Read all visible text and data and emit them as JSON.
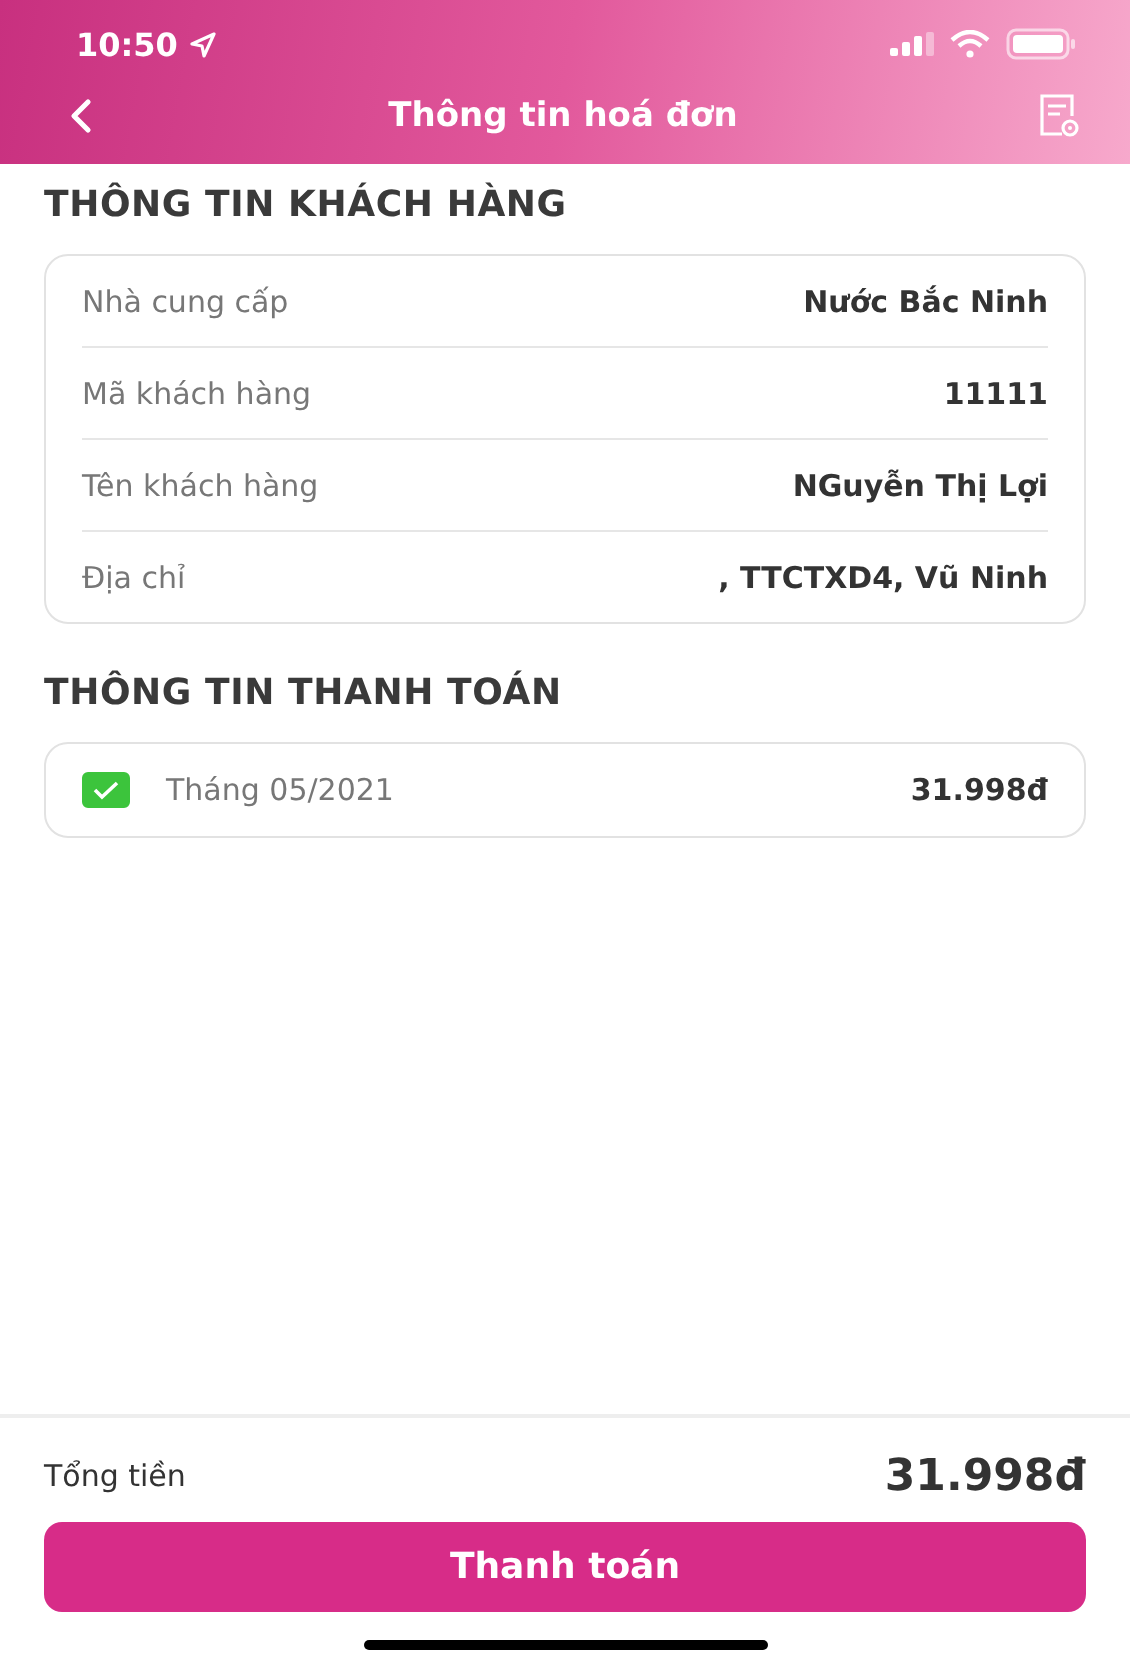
{
  "status_bar": {
    "time": "10:50"
  },
  "header": {
    "title": "Thông tin hoá đơn"
  },
  "customer_section": {
    "title": "THÔNG TIN KHÁCH HÀNG",
    "rows": [
      {
        "label": "Nhà cung cấp",
        "value": "Nước Bắc Ninh"
      },
      {
        "label": "Mã khách hàng",
        "value": "11111"
      },
      {
        "label": "Tên khách hàng",
        "value": "NGuyễn Thị Lợi"
      },
      {
        "label": "Địa chỉ",
        "value": ", TTCTXD4, Vũ Ninh"
      }
    ]
  },
  "payment_section": {
    "title": "THÔNG TIN THANH TOÁN",
    "bills": [
      {
        "label": "Tháng 05/2021",
        "amount": "31.998đ",
        "checked": true
      }
    ]
  },
  "footer": {
    "total_label": "Tổng tiền",
    "total": "31.998đ",
    "button": "Thanh toán"
  }
}
